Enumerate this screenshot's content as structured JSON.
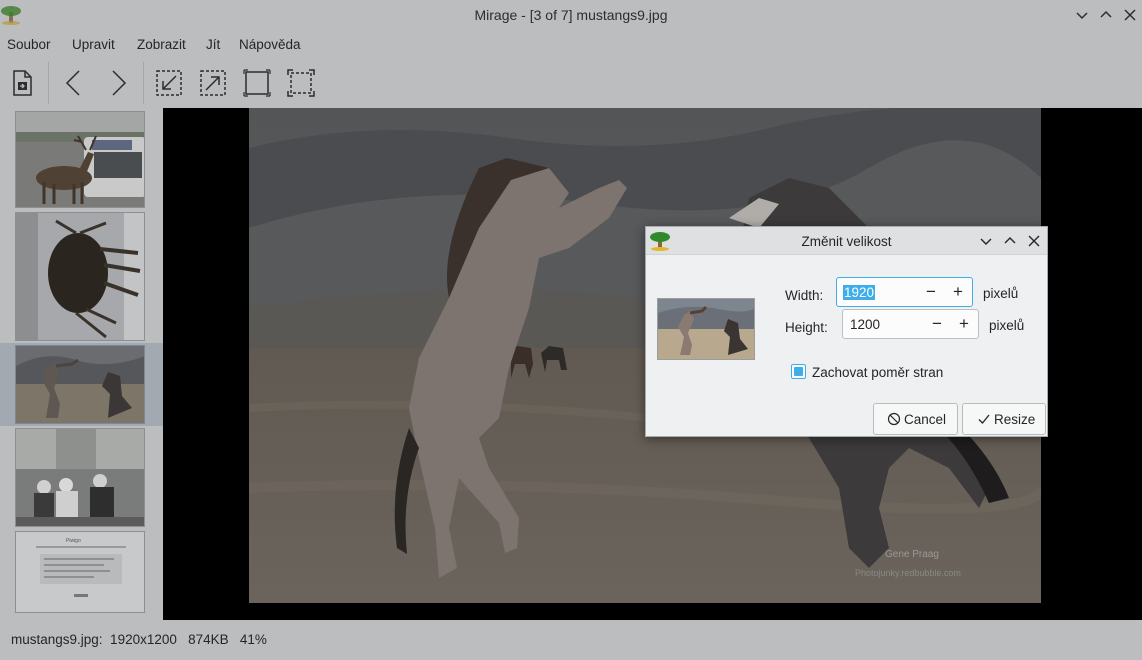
{
  "window": {
    "title": "Mirage - [3 of 7] mustangs9.jpg"
  },
  "menu": {
    "items": [
      "Soubor",
      "Upravit",
      "Zobrazit",
      "Jít",
      "Nápověda"
    ]
  },
  "toolbar": {
    "icons": [
      "open-file-icon",
      "prev-icon",
      "next-icon",
      "zoom-in-icon",
      "zoom-out-icon",
      "zoom-fit-icon",
      "zoom-100-icon"
    ]
  },
  "photo": {
    "watermark_line1": "Gene Praag",
    "watermark_line2": "Photojunky.redbubble.com"
  },
  "thumbnails": {
    "page_title": "Piwigo"
  },
  "statusbar": {
    "text": "mustangs9.jpg:  1920x1200   874KB   41%"
  },
  "dialog": {
    "title": "Změnit velikost",
    "width_label": "Width:",
    "width_value": "1920",
    "height_label": "Height:",
    "height_value": "1200",
    "unit_label": "pixelů",
    "keep_ratio_label": "Zachovat poměr stran",
    "keep_ratio_checked": true,
    "cancel_label": "Cancel",
    "resize_label": "Resize"
  },
  "colors": {
    "accent": "#3daee9",
    "window_bg": "#eff0f1"
  }
}
